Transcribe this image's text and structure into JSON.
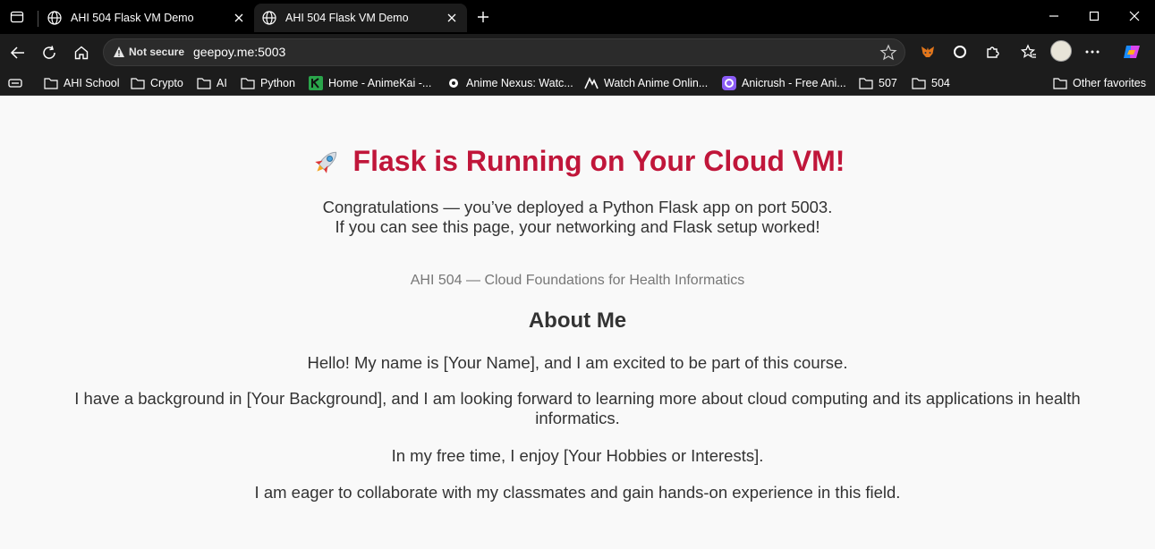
{
  "tabs": [
    {
      "title": "AHI 504 Flask VM Demo"
    },
    {
      "title": "AHI 504 Flask VM Demo"
    }
  ],
  "address_bar": {
    "security_label": "Not secure",
    "url": "geepoy.me:5003"
  },
  "bookmarks": [
    {
      "label": "AHI School",
      "icon": "folder-icon"
    },
    {
      "label": "Crypto",
      "icon": "folder-icon"
    },
    {
      "label": "AI",
      "icon": "folder-icon"
    },
    {
      "label": "Python",
      "icon": "folder-icon"
    },
    {
      "label": "Home - AnimeKai -...",
      "icon": "animekai-icon"
    },
    {
      "label": "Anime Nexus: Watc...",
      "icon": "animenexus-icon"
    },
    {
      "label": "Watch Anime Onlin...",
      "icon": "anime-site-icon"
    },
    {
      "label": "Anicrush - Free Ani...",
      "icon": "anicrush-icon"
    },
    {
      "label": "507",
      "icon": "folder-icon"
    },
    {
      "label": "504",
      "icon": "folder-icon"
    },
    {
      "label": "Other favorites",
      "icon": "folder-icon"
    }
  ],
  "page": {
    "title": "Flask is Running on Your Cloud VM!",
    "intro_line1": "Congratulations — you’ve deployed a Python Flask app on port 5003.",
    "intro_line2": "If you can see this page, your networking and Flask setup worked!",
    "course": "AHI 504 — Cloud Foundations for Health Informatics",
    "about_heading": "About Me",
    "paragraphs": [
      "Hello! My name is [Your Name], and I am excited to be part of this course.",
      "I have a background in [Your Background], and I am looking forward to learning more about cloud computing and its applications in health informatics.",
      "In my free time, I enjoy [Your Hobbies or Interests].",
      "I am eager to collaborate with my classmates and gain hands-on experience in this field."
    ]
  },
  "colors": {
    "title": "#c0163a",
    "chrome_bg": "#1c1c1c",
    "page_bg": "#f9f9f9"
  }
}
